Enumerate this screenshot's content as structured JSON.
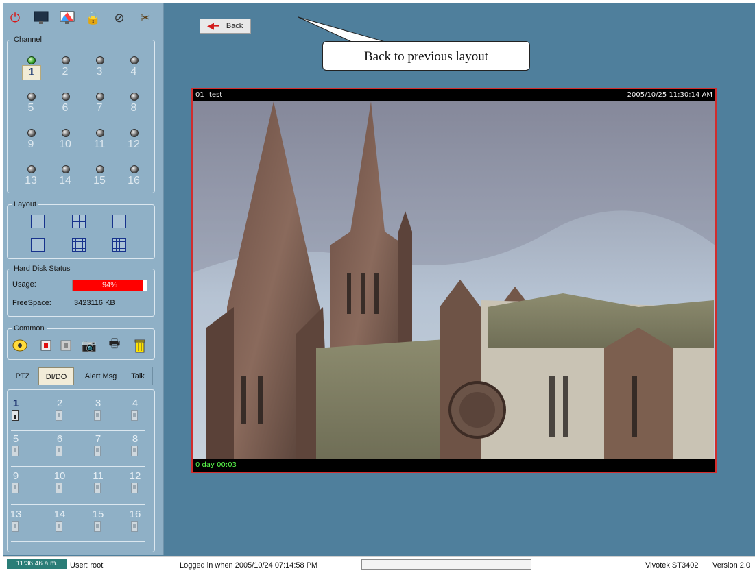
{
  "toolbar": {
    "icons": [
      "power-icon",
      "monitor-icon",
      "color-monitor-icon",
      "lock-icon",
      "settings-icon",
      "tools-icon"
    ]
  },
  "channel": {
    "legend": "Channel",
    "items": [
      "1",
      "2",
      "3",
      "4",
      "5",
      "6",
      "7",
      "8",
      "9",
      "10",
      "11",
      "12",
      "13",
      "14",
      "15",
      "16"
    ],
    "selected": "1"
  },
  "layout": {
    "legend": "Layout"
  },
  "hard_disk": {
    "legend": "Hard Disk Status",
    "usage_label": "Usage:",
    "usage_value": "94%",
    "usage_fraction": 0.94,
    "free_label": "FreeSpace:",
    "free_value": "3423116 KB"
  },
  "common": {
    "legend": "Common"
  },
  "tabs": {
    "ptz": "PTZ",
    "dido": "DI/DO",
    "alert": "Alert Msg",
    "talk": "Talk"
  },
  "dio": {
    "numbers": [
      "1",
      "2",
      "3",
      "4",
      "5",
      "6",
      "7",
      "8",
      "9",
      "10",
      "11",
      "12",
      "13",
      "14",
      "15",
      "16"
    ]
  },
  "main": {
    "back_label": "Back",
    "callout": "Back to previous layout",
    "video": {
      "channel": "01",
      "name": "test",
      "timestamp": "2005/10/25 11:30:14 AM",
      "elapsed": "0 day  00:03"
    }
  },
  "status": {
    "time": "11:36:46 a.m.",
    "user": "User: root",
    "logged": "Logged in when  2005/10/24 07:14:58 PM",
    "product": "Vivotek ST3402",
    "version": "Version 2.0"
  },
  "colors": {
    "accent": "#d12d2d",
    "panel": "#8fb0c6",
    "workspace": "#4f7f9c",
    "usage_bar": "#ff0000"
  }
}
